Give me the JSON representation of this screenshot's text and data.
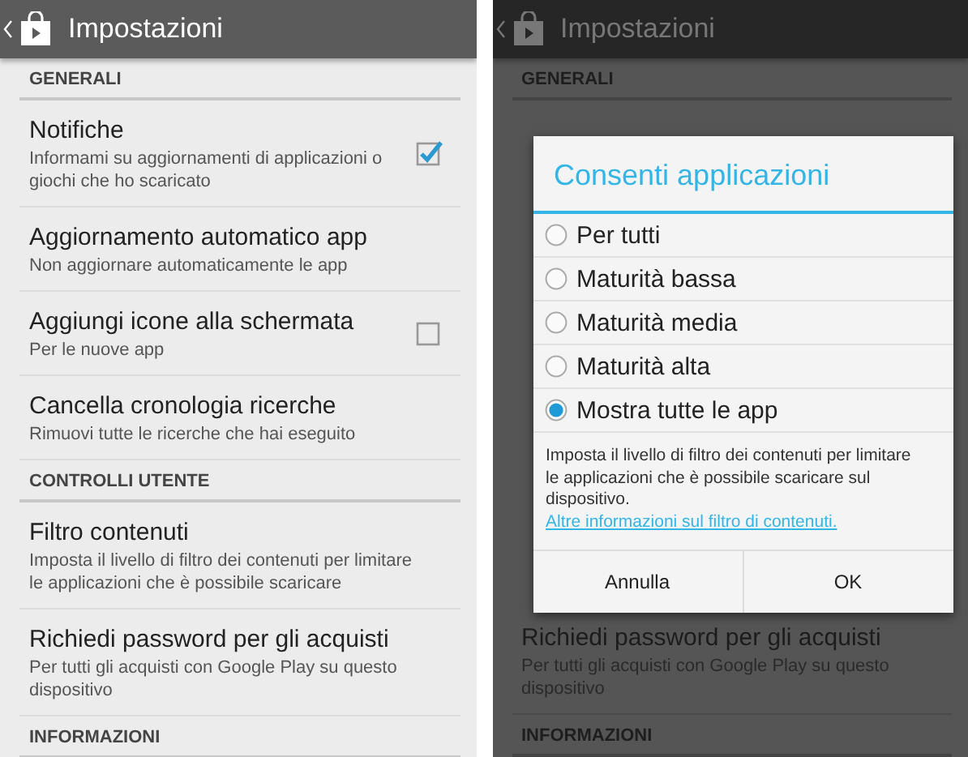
{
  "screens": [
    {
      "dimmed": false,
      "app_bar": {
        "title": "Impostazioni"
      },
      "rows": [
        {
          "kind": "header",
          "text": "GENERALI"
        },
        {
          "kind": "checkbox",
          "title": "Notifiche",
          "summary": "Informami su aggiornamenti di applicazioni o giochi che ho scaricato",
          "checked": true
        },
        {
          "kind": "item",
          "title": "Aggiornamento automatico app",
          "summary": "Non aggiornare automaticamente le app"
        },
        {
          "kind": "checkbox",
          "title": "Aggiungi icone alla schermata",
          "summary": "Per le nuove app",
          "checked": false
        },
        {
          "kind": "item",
          "title": "Cancella cronologia ricerche",
          "summary": "Rimuovi tutte le ricerche che hai eseguito"
        },
        {
          "kind": "header",
          "text": "CONTROLLI UTENTE"
        },
        {
          "kind": "item",
          "title": "Filtro contenuti",
          "summary": "Imposta il livello di filtro dei contenuti per limitare le applicazioni che è possibile scaricare"
        },
        {
          "kind": "item",
          "title": "Richiedi password per gli acquisti",
          "summary": "Per tutti gli acquisti con Google Play su questo dispositivo"
        },
        {
          "kind": "header",
          "text": "INFORMAZIONI"
        }
      ]
    },
    {
      "dimmed": true,
      "app_bar": {
        "title": "Impostazioni"
      },
      "rows": [
        {
          "kind": "header",
          "text": "GENERALI"
        }
      ],
      "bottom_rows": [
        {
          "kind": "item",
          "title": "Richiedi password per gli acquisti",
          "summary": "Per tutti gli acquisti con Google Play su questo dispositivo"
        },
        {
          "kind": "header",
          "text": "INFORMAZIONI"
        }
      ],
      "dialog": {
        "title": "Consenti applicazioni",
        "options": [
          {
            "label": "Per tutti",
            "selected": false
          },
          {
            "label": "Maturità bassa",
            "selected": false
          },
          {
            "label": "Maturità media",
            "selected": false
          },
          {
            "label": "Maturità alta",
            "selected": false
          },
          {
            "label": "Mostra tutte le app",
            "selected": true
          }
        ],
        "description": "Imposta il livello di filtro dei contenuti per limitare le applicazioni che è possibile scaricare sul dispositivo.",
        "link": "Altre informazioni sul filtro di contenuti.",
        "buttons": [
          "Annulla",
          "OK"
        ]
      }
    }
  ]
}
